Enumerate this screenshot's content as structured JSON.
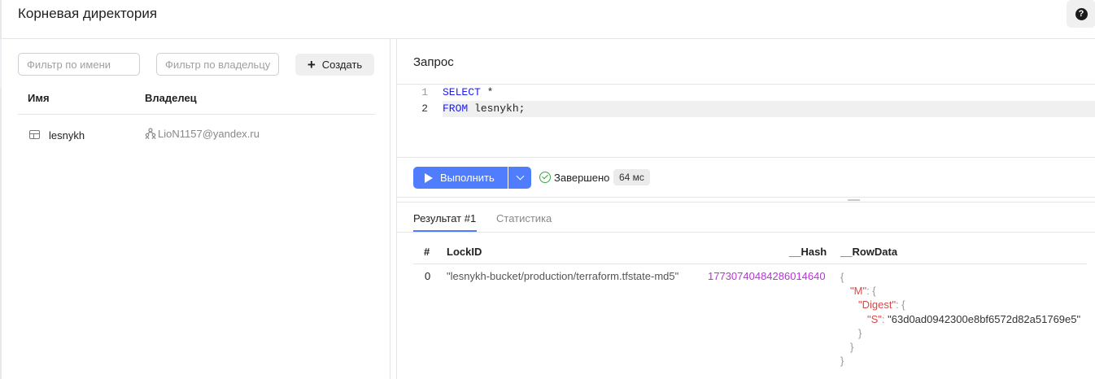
{
  "header": {
    "title": "Корневая директория",
    "help_glyph": "?"
  },
  "left": {
    "filter_name_placeholder": "Фильтр по имени",
    "filter_owner_placeholder": "Фильтр по владельцу",
    "create_label": "Создать",
    "columns": {
      "name": "Имя",
      "owner": "Владелец"
    },
    "items": [
      {
        "name": "lesnykh",
        "owner": "LioN1157@yandex.ru",
        "icon": "table-icon"
      }
    ]
  },
  "query": {
    "title": "Запрос",
    "lines": [
      {
        "num": "1",
        "keyword": "SELECT",
        "rest": " *"
      },
      {
        "num": "2",
        "keyword": "FROM",
        "rest": " lesnykh;"
      }
    ]
  },
  "run": {
    "label": "Выполнить",
    "status": "Завершено",
    "duration": "64 мс"
  },
  "tabs": [
    {
      "label": "Результат #1",
      "active": true
    },
    {
      "label": "Статистика",
      "active": false
    }
  ],
  "results": {
    "columns": [
      "#",
      "LockID",
      "__Hash",
      "__RowData"
    ],
    "rows": [
      {
        "index": "0",
        "lock_id": "\"lesnykh-bucket/production/terraform.tfstate-md5\"",
        "hash": "17730740484286014640",
        "row_data": {
          "key_m": "\"M\"",
          "key_digest": "\"Digest\"",
          "key_s": "\"S\"",
          "value_s": "\"63d0ad0942300e8bf6572d82a51769e5\""
        }
      }
    ]
  },
  "colors": {
    "accent": "#4f7dfd",
    "success": "#3aa541",
    "hash": "#b535d6",
    "json_key": "#d84a4a"
  }
}
